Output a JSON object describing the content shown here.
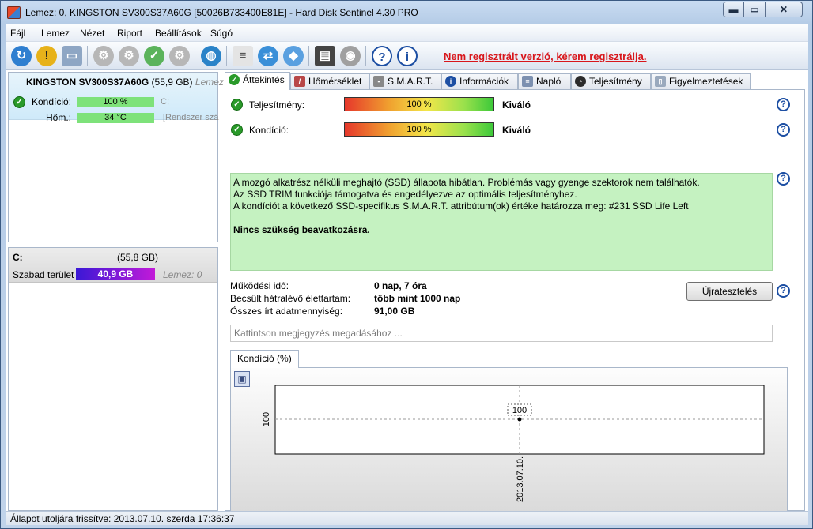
{
  "window": {
    "title": "Lemez: 0, KINGSTON SV300S37A60G [50026B733400E81E]  -  Hard Disk Sentinel 4.30 PRO",
    "min_glyph": "▬",
    "max_glyph": "▭",
    "close_glyph": "✕"
  },
  "menu": [
    "Fájl",
    "Lemez",
    "Nézet",
    "Riport",
    "Beállítások",
    "Súgó"
  ],
  "toolbar": {
    "icons": [
      "refresh-icon",
      "warning-icon",
      "disk-icon",
      "disk-tool-icon",
      "disk-tool-icon",
      "disk-check-icon",
      "disk-tool-icon",
      "globe-icon",
      "report-icon",
      "update-icon",
      "network-icon",
      "monitor-icon",
      "speaker-icon",
      "help-icon",
      "info-icon"
    ],
    "registration_link": "Nem regisztrált verzió, kérem regisztrálja."
  },
  "disk_panel": {
    "name": "KINGSTON SV300S37A60G",
    "size": "(55,9 GB)",
    "extra": "Lemez",
    "condition_label": "Kondíció:",
    "condition_value": "100 %",
    "condition_drive": "C;",
    "temp_label": "Hőm.:",
    "temp_value": "34 °C",
    "temp_extra": "[Rendszer szá"
  },
  "partition_panel": {
    "drive": "C:",
    "size": "(55,8 GB)",
    "free_label": "Szabad terület",
    "free_value": "40,9 GB",
    "free_extra": "Lemez: 0"
  },
  "tabs": [
    "Áttekintés",
    "Hőmérséklet",
    "S.M.A.R.T.",
    "Információk",
    "Napló",
    "Teljesítmény",
    "Figyelmeztetések"
  ],
  "overview": {
    "performance_label": "Teljesítmény:",
    "performance_value": "100 %",
    "performance_text": "Kiváló",
    "condition_label": "Kondíció:",
    "condition_value": "100 %",
    "condition_text": "Kiváló",
    "info_lines": [
      "A mozgó alkatrész nélküli meghajtó (SSD) állapota hibátlan. Problémás vagy gyenge szektorok nem találhatók.",
      "Az SSD TRIM funkciója támogatva és engedélyezve az optimális teljesítményhez.",
      "A kondíciót a következő SSD-specifikus S.M.A.R.T. attribútum(ok) értéke határozza meg:  #231 SSD Life Left"
    ],
    "info_strong": "Nincs szükség beavatkozásra.",
    "uptime_label": "Működési idő:",
    "uptime_value": "0 nap, 7 óra",
    "remaining_label": "Becsült hátralévő élettartam:",
    "remaining_value": "több mint 1000 nap",
    "written_label": "Összes írt adatmennyiség:",
    "written_value": "91,00 GB",
    "retest_button": "Újratesztelés",
    "note_placeholder": "Kattintson megjegyzés megadásához ..."
  },
  "chart_tab": "Kondíció  (%)",
  "chart_data": {
    "type": "line",
    "x": [
      "2013.07.10."
    ],
    "series": [
      {
        "values": [
          100
        ]
      }
    ],
    "data_labels": [
      "100"
    ],
    "ytick": "100",
    "grid": true
  },
  "status_bar": "Állapot utoljára frissítve: 2013.07.10. szerda 17:36:37"
}
